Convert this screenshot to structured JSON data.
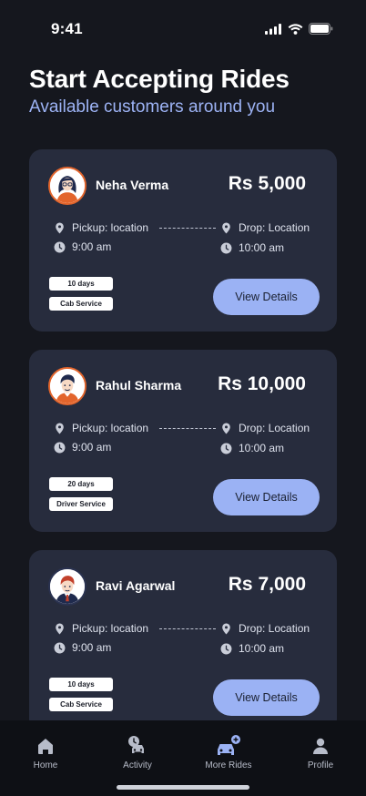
{
  "status_bar": {
    "time": "9:41"
  },
  "header": {
    "title": "Start Accepting Rides",
    "subtitle": "Available customers around you"
  },
  "colors": {
    "accent": "#9bb2f4",
    "card": "#272c3d",
    "background": "#15171e",
    "avatar_border": "#e3652c"
  },
  "rides": [
    {
      "name": "Neha Verma",
      "fare": "Rs 5,000",
      "pickup": "Pickup: location",
      "pickup_time": "9:00 am",
      "drop": "Drop: Location",
      "drop_time": "10:00 am",
      "duration": "10 days",
      "service": "Cab Service",
      "button": "View Details",
      "avatar_icon": "woman-avatar-icon"
    },
    {
      "name": "Rahul Sharma",
      "fare": "Rs 10,000",
      "pickup": "Pickup: location",
      "pickup_time": "9:00 am",
      "drop": "Drop: Location",
      "drop_time": "10:00 am",
      "duration": "20 days",
      "service": "Driver Service",
      "button": "View Details",
      "avatar_icon": "man-avatar-icon"
    },
    {
      "name": "Ravi Agarwal",
      "fare": "Rs 7,000",
      "pickup": "Pickup: location",
      "pickup_time": "9:00 am",
      "drop": "Drop: Location",
      "drop_time": "10:00 am",
      "duration": "10 days",
      "service": "Cab Service",
      "button": "View Details",
      "avatar_icon": "man-avatar-icon"
    }
  ],
  "nav": [
    {
      "label": "Home",
      "icon": "home-icon"
    },
    {
      "label": "Activity",
      "icon": "activity-icon"
    },
    {
      "label": "More Rides",
      "icon": "car-plus-icon"
    },
    {
      "label": "Profile",
      "icon": "profile-icon"
    }
  ]
}
